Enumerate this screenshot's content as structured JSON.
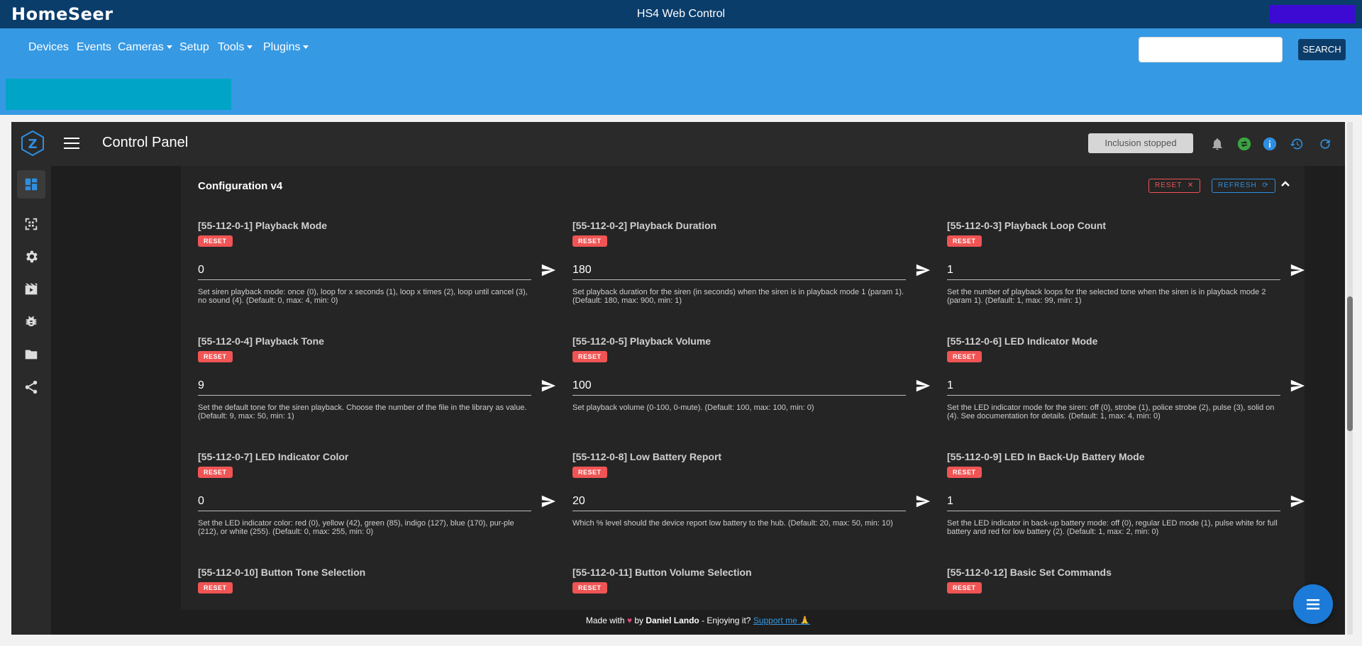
{
  "header": {
    "logo": "HomeSeer",
    "title": "HS4 Web Control",
    "user_color": "#3d0ad4"
  },
  "nav": {
    "items": [
      {
        "label": "Devices",
        "dropdown": false
      },
      {
        "label": "Events",
        "dropdown": false
      },
      {
        "label": "Cameras",
        "dropdown": true
      },
      {
        "label": "Setup",
        "dropdown": false
      },
      {
        "label": "Tools",
        "dropdown": true
      },
      {
        "label": "Plugins",
        "dropdown": true
      }
    ],
    "search_placeholder": "",
    "search_button": "SEARCH"
  },
  "app": {
    "title": "Control Panel",
    "inclusion_status": "Inclusion stopped",
    "header_icons": [
      "bell-off-icon",
      "sync-icon",
      "info-icon",
      "history-icon",
      "refresh-icon"
    ],
    "sidebar_icons": [
      "dashboard-icon",
      "qr-scan-icon",
      "settings-icon",
      "scenes-icon",
      "debug-icon",
      "folder-icon",
      "share-icon"
    ]
  },
  "config": {
    "title": "Configuration v4",
    "reset_label": "RESET",
    "refresh_label": "REFRESH",
    "params": [
      {
        "title": "[55-112-0-1] Playback Mode",
        "reset": "RESET",
        "value": "0",
        "desc": "Set siren playback mode: once (0), loop for x seconds (1), loop x times (2), loop until cancel (3), no sound (4). (Default: 0, max: 4, min: 0)"
      },
      {
        "title": "[55-112-0-2] Playback Duration",
        "reset": "RESET",
        "value": "180",
        "desc": "Set playback duration for the siren (in seconds) when the siren is in playback mode 1 (param 1). (Default: 180, max: 900, min: 1)"
      },
      {
        "title": "[55-112-0-3] Playback Loop Count",
        "reset": "RESET",
        "value": "1",
        "desc": "Set the number of playback loops for the selected tone when the siren is in playback mode 2 (param 1). (Default: 1, max: 99, min: 1)"
      },
      {
        "title": "[55-112-0-4] Playback Tone",
        "reset": "RESET",
        "value": "9",
        "desc": "Set the default tone for the siren playback. Choose the number of the file in the library as value. (Default: 9, max: 50, min: 1)"
      },
      {
        "title": "[55-112-0-5] Playback Volume",
        "reset": "RESET",
        "value": "100",
        "desc": "Set playback volume (0-100, 0-mute). (Default: 100, max: 100, min: 0)"
      },
      {
        "title": "[55-112-0-6] LED Indicator Mode",
        "reset": "RESET",
        "value": "1",
        "desc": "Set the LED indicator mode for the siren: off (0), strobe (1), police strobe (2), pulse (3), solid on (4). See documentation for details. (Default: 1, max: 4, min: 0)"
      },
      {
        "title": "[55-112-0-7] LED Indicator Color",
        "reset": "RESET",
        "value": "0",
        "desc": "Set the LED indicator color: red (0), yellow (42), green (85), indigo (127), blue (170), pur-ple (212), or white (255). (Default: 0, max: 255, min: 0)"
      },
      {
        "title": "[55-112-0-8] Low Battery Report",
        "reset": "RESET",
        "value": "20",
        "desc": "Which % level should the device report low battery to the hub. (Default: 20, max: 50, min: 10)"
      },
      {
        "title": "[55-112-0-9] LED In Back-Up Battery Mode",
        "reset": "RESET",
        "value": "1",
        "desc": "Set the LED indicator in back-up battery mode: off (0), regular LED mode (1), pulse white for full battery and red for low battery (2). (Default: 1, max: 2, min: 0)"
      },
      {
        "title": "[55-112-0-10] Button Tone Selection",
        "reset": "RESET",
        "value": "",
        "desc": ""
      },
      {
        "title": "[55-112-0-11] Button Volume Selection",
        "reset": "RESET",
        "value": "",
        "desc": ""
      },
      {
        "title": "[55-112-0-12] Basic Set Commands",
        "reset": "RESET",
        "value": "",
        "desc": ""
      }
    ]
  },
  "footer": {
    "made_with": "Made with",
    "by": "by",
    "author": "Daniel Lando",
    "enjoy": "- Enjoying it?",
    "support": "Support me 🙏"
  }
}
